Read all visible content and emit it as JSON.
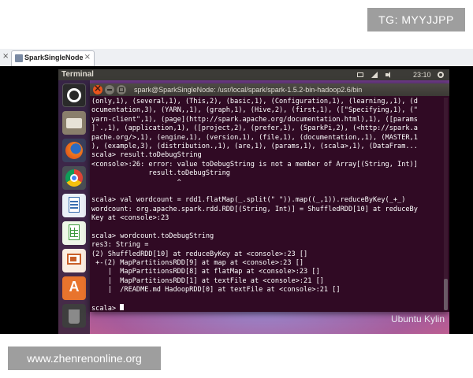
{
  "watermarks": {
    "top": "TG: MYYJJPP",
    "bottom": "www.zhenrenonline.org"
  },
  "vm": {
    "tab_label": "SparkSingleNode"
  },
  "ubuntu": {
    "panel_title": "Terminal",
    "clock": "23:10",
    "desktop_brand": "Ubuntu Kylin",
    "launcher": [
      "ubuntu-dash-icon",
      "files-icon",
      "firefox-icon",
      "chromium-icon",
      "libreoffice-writer-icon",
      "libreoffice-calc-icon",
      "libreoffice-impress-icon",
      "software-center-icon",
      "trash-icon"
    ]
  },
  "terminal": {
    "title": "spark@SparkSingleNode: /usr/local/spark/spark-1.5.2-bin-hadoop2.6/bin",
    "lines": [
      "(only,1), (several,1), (This,2), (basic,1), (Configuration,1), (learning,,1), (d",
      "ocumentation,3), (YARN,,1), (graph,1), (Hive,2), (first,1), ([\"Specifying,1), (\"",
      "yarn-client\",1), (page](http://spark.apache.org/documentation.html),1), ([params",
      "]`.,1), (application,1), ([project,2), (prefer,1), (SparkPi,2), (<http://spark.a",
      "pache.org/>,1), (engine,1), (version,1), (file,1), (documentation,,1), (MASTER,1",
      "), (example,3), (distribution.,1), (are,1), (params,1), (scala>,1), (DataFram...",
      "scala> result.toDebugString",
      "<console>:26: error: value toDebugString is not a member of Array[(String, Int)]",
      "              result.toDebugString",
      "                     ^",
      "",
      "scala> val wordcount = rdd1.flatMap(_.split(\" \")).map((_,1)).reduceByKey(_+_)",
      "wordcount: org.apache.spark.rdd.RDD[(String, Int)] = ShuffledRDD[10] at reduceBy",
      "Key at <console>:23",
      "",
      "scala> wordcount.toDebugString",
      "res3: String =",
      "(2) ShuffledRDD[10] at reduceByKey at <console>:23 []",
      " +-(2) MapPartitionsRDD[9] at map at <console>:23 []",
      "    |  MapPartitionsRDD[8] at flatMap at <console>:23 []",
      "    |  MapPartitionsRDD[1] at textFile at <console>:21 []",
      "    |  /README.md HadoopRDD[0] at textFile at <console>:21 []",
      "",
      "scala> "
    ]
  }
}
